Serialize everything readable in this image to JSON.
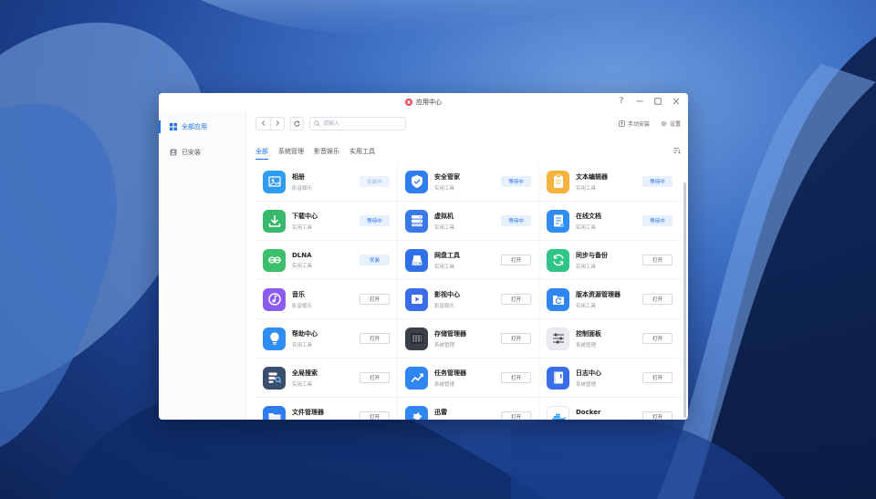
{
  "window": {
    "title": "应用中心",
    "controls": {
      "help": "?",
      "minimize": "minimize",
      "maximize": "maximize",
      "close": "close"
    }
  },
  "sidebar": {
    "items": [
      {
        "label": "全部应用",
        "icon": "grid-icon",
        "active": true
      },
      {
        "label": "已安装",
        "icon": "installed-icon",
        "active": false
      }
    ]
  },
  "toolbar": {
    "search_placeholder": "请输入",
    "manual_install": "手动安装",
    "settings": "设置"
  },
  "tabs": [
    {
      "label": "全部",
      "active": true
    },
    {
      "label": "系统管理",
      "active": false
    },
    {
      "label": "影音娱乐",
      "active": false
    },
    {
      "label": "实用工具",
      "active": false
    }
  ],
  "apps": [
    {
      "name": "相册",
      "category": "影音娱乐",
      "button": "安装中",
      "state": "installing",
      "icon": "photo-icon",
      "color": "#2f9cf0"
    },
    {
      "name": "安全管家",
      "category": "实用工具",
      "button": "等待中",
      "state": "waiting",
      "icon": "shield-icon",
      "color": "#2f7ef0"
    },
    {
      "name": "文本编辑器",
      "category": "实用工具",
      "button": "等待中",
      "state": "waiting",
      "icon": "clipboard-icon",
      "color": "#f5b23d"
    },
    {
      "name": "下载中心",
      "category": "实用工具",
      "button": "等待中",
      "state": "waiting",
      "icon": "download-icon",
      "color": "#37b86a"
    },
    {
      "name": "虚拟机",
      "category": "实用工具",
      "button": "等待中",
      "state": "waiting",
      "icon": "server-icon",
      "color": "#3a78e8"
    },
    {
      "name": "在线文档",
      "category": "实用工具",
      "button": "等待中",
      "state": "waiting",
      "icon": "document-icon",
      "color": "#2f8cf0"
    },
    {
      "name": "DLNA",
      "category": "实用工具",
      "button": "安装",
      "state": "install",
      "icon": "dlna-icon",
      "color": "#3cbf6a"
    },
    {
      "name": "网盘工具",
      "category": "实用工具",
      "button": "打开",
      "state": "open",
      "icon": "cloud-drive-icon",
      "color": "#2f6fe8"
    },
    {
      "name": "同步与备份",
      "category": "实用工具",
      "button": "打开",
      "state": "open",
      "icon": "sync-icon",
      "color": "#2fc488"
    },
    {
      "name": "音乐",
      "category": "影音娱乐",
      "button": "打开",
      "state": "open",
      "icon": "music-icon",
      "color": "#8a5cf0"
    },
    {
      "name": "影视中心",
      "category": "影音娱乐",
      "button": "打开",
      "state": "open",
      "icon": "video-icon",
      "color": "#3a6ee8"
    },
    {
      "name": "版本资源管理器",
      "category": "实用工具",
      "button": "打开",
      "state": "open",
      "icon": "version-icon",
      "color": "#2f86f0"
    },
    {
      "name": "帮助中心",
      "category": "实用工具",
      "button": "打开",
      "state": "open",
      "icon": "lightbulb-icon",
      "color": "#2f8cf0"
    },
    {
      "name": "存储管理器",
      "category": "系统管理",
      "button": "打开",
      "state": "open",
      "icon": "storage-icon",
      "color": "#3b3f47"
    },
    {
      "name": "控制面板",
      "category": "系统管理",
      "button": "打开",
      "state": "open",
      "icon": "sliders-icon",
      "color": "#e9ebef"
    },
    {
      "name": "全局搜索",
      "category": "实用工具",
      "button": "打开",
      "state": "open",
      "icon": "global-search-icon",
      "color": "#3c4e6e"
    },
    {
      "name": "任务管理器",
      "category": "系统管理",
      "button": "打开",
      "state": "open",
      "icon": "task-chart-icon",
      "color": "#2f86f0"
    },
    {
      "name": "日志中心",
      "category": "系统管理",
      "button": "打开",
      "state": "open",
      "icon": "log-book-icon",
      "color": "#3a6ee8"
    },
    {
      "name": "文件管理器",
      "category": "实用工具",
      "button": "打开",
      "state": "open",
      "icon": "folder-icon",
      "color": "#2f7ef0"
    },
    {
      "name": "迅雷",
      "category": "实用工具",
      "button": "打开",
      "state": "open",
      "icon": "thunder-icon",
      "color": "#2f86f0"
    },
    {
      "name": "Docker",
      "category": "实用工具",
      "button": "打开",
      "state": "open",
      "icon": "docker-icon",
      "color": "#ffffff"
    }
  ]
}
